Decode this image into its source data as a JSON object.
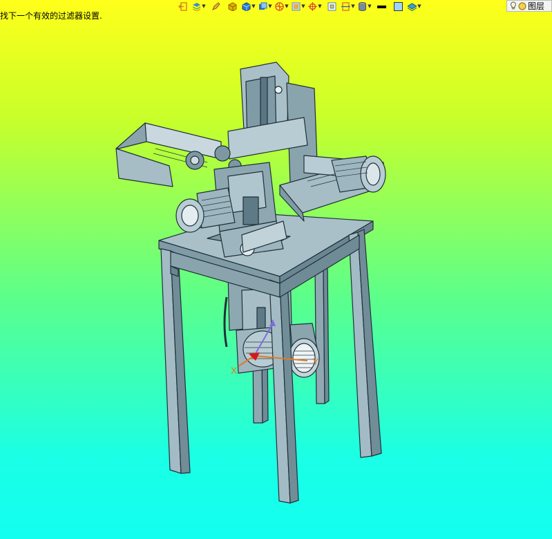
{
  "status_bar": {
    "message": "找下一个有效的过滤器设置."
  },
  "toolbar": {
    "buttons": [
      {
        "name": "exit-icon",
        "color": "#d48a1c"
      },
      {
        "name": "layers-stack-icon",
        "color": "#3a8fd0"
      },
      {
        "name": "pencil-icon",
        "color": "#c0392b"
      },
      {
        "name": "box-shaded-icon",
        "color": "#e5b100"
      },
      {
        "name": "cube-blue-icon",
        "color": "#2a7bd1"
      },
      {
        "name": "view-cube-icon",
        "color": "#2b6fbf"
      },
      {
        "name": "render-sphere-icon",
        "color": "#e0552a"
      },
      {
        "name": "display-mode-icon",
        "color": "#6b8fb3"
      },
      {
        "name": "snap-target-icon",
        "color": "#d9442b"
      },
      {
        "name": "zoom-window-icon",
        "color": "#4f7fb0"
      },
      {
        "name": "section-view-icon",
        "color": "#d9821b"
      },
      {
        "name": "cylinder-icon",
        "color": "#7a8a9a"
      },
      {
        "name": "line-color-icon",
        "color": "#000000"
      },
      {
        "name": "fill-color-icon",
        "color": "#9fd4ff"
      },
      {
        "name": "layer-plane-icon",
        "color": "#39a0c9"
      }
    ]
  },
  "layer_selector": {
    "label": "图层"
  },
  "axes": {
    "x_label": "X",
    "y_label": "Y"
  },
  "colors": {
    "model_fill": "#9cb6c0",
    "model_dark": "#6f8b96",
    "model_edge": "#1f2f38"
  }
}
